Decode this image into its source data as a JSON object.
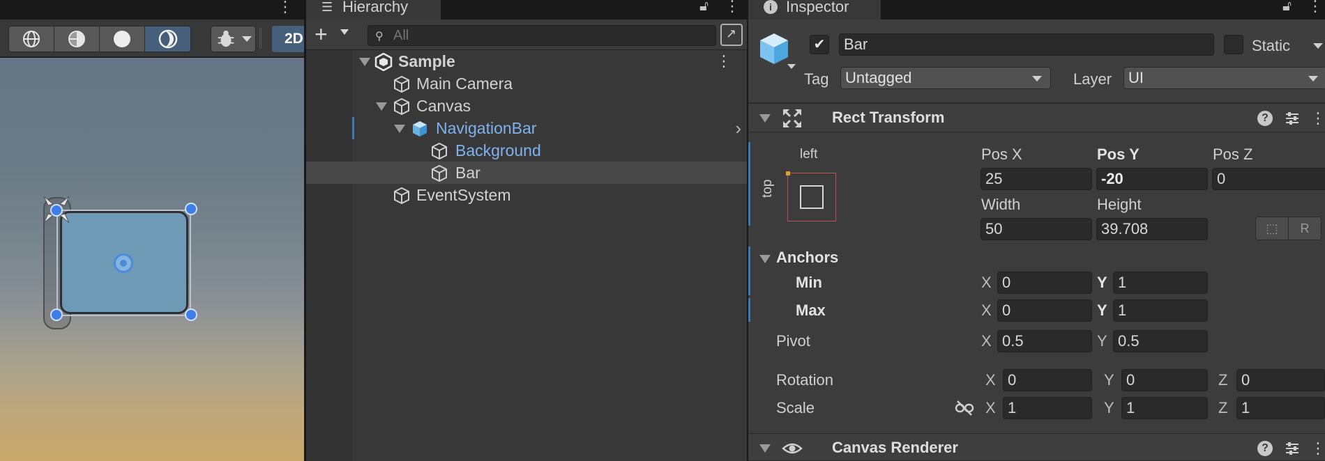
{
  "scene": {
    "toolbar": {
      "mode_2d_label": "2D",
      "buttons": [
        "wireframe-sphere-icon",
        "shaded-wireframe-sphere-icon",
        "shaded-sphere-icon",
        "skybox-moon-icon"
      ]
    }
  },
  "hierarchy": {
    "tab_label": "Hierarchy",
    "search": {
      "placeholder": "All",
      "value": ""
    },
    "tree": {
      "scene": "Sample",
      "main_camera": "Main Camera",
      "canvas": "Canvas",
      "navigation_bar": "NavigationBar",
      "background": "Background",
      "bar": "Bar",
      "event_system": "EventSystem"
    }
  },
  "inspector": {
    "tab_label": "Inspector",
    "object_name": "Bar",
    "static_label": "Static",
    "tag_label": "Tag",
    "tag_value": "Untagged",
    "layer_label": "Layer",
    "layer_value": "UI",
    "rect_transform": {
      "title": "Rect Transform",
      "anchor_preset_h": "left",
      "anchor_preset_v": "top",
      "pos_x_label": "Pos X",
      "pos_y_label": "Pos Y",
      "pos_z_label": "Pos Z",
      "pos_x": "25",
      "pos_y": "-20",
      "pos_z": "0",
      "width_label": "Width",
      "height_label": "Height",
      "width": "50",
      "height": "39.708",
      "raw_edit_label": "R",
      "anchors_label": "Anchors",
      "min_label": "Min",
      "max_label": "Max",
      "min_x": "0",
      "min_y": "1",
      "max_x": "0",
      "max_y": "1",
      "pivot_label": "Pivot",
      "pivot_x": "0.5",
      "pivot_y": "0.5",
      "rotation_label": "Rotation",
      "rot_x": "0",
      "rot_y": "0",
      "rot_z": "0",
      "scale_label": "Scale",
      "scale_x": "1",
      "scale_y": "1",
      "scale_z": "1",
      "x_label": "X",
      "y_label": "Y",
      "z_label": "Z"
    },
    "canvas_renderer": {
      "title": "Canvas Renderer"
    }
  },
  "colors": {
    "accent": "#46607c",
    "selection_text": "#7fb2ee",
    "panel_bg": "#383838",
    "inspector_bg": "#3c3c3c"
  }
}
